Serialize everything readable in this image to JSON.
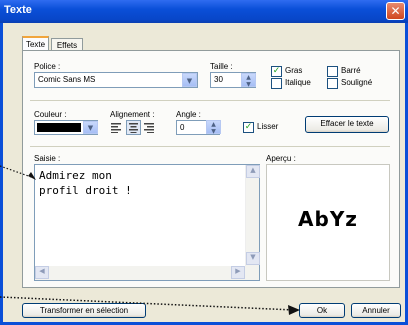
{
  "window": {
    "title": "Texte",
    "close": "✕"
  },
  "tabs": [
    {
      "label": "Texte",
      "active": true
    },
    {
      "label": "Effets",
      "active": false
    }
  ],
  "police": {
    "label": "Police :",
    "value": "Comic Sans MS"
  },
  "taille": {
    "label": "Taille :",
    "value": "30"
  },
  "style": {
    "gras": "Gras",
    "italique": "Italique",
    "barre": "Barré",
    "souligne": "Souligné"
  },
  "couleur": {
    "label": "Couleur :",
    "value": "#000000"
  },
  "alignement": {
    "label": "Alignement :"
  },
  "angle": {
    "label": "Angle :",
    "value": "0"
  },
  "lisser": {
    "label": "Lisser"
  },
  "effacer": {
    "label": "Effacer le texte"
  },
  "saisie": {
    "label": "Saisie :",
    "line1": "Admirez mon",
    "line2": "profil droit !"
  },
  "apercu": {
    "label": "Aperçu :",
    "preview": "AbYz"
  },
  "buttons": {
    "transformer": "Transformer en sélection",
    "ok": "Ok",
    "annuler": "Annuler"
  }
}
